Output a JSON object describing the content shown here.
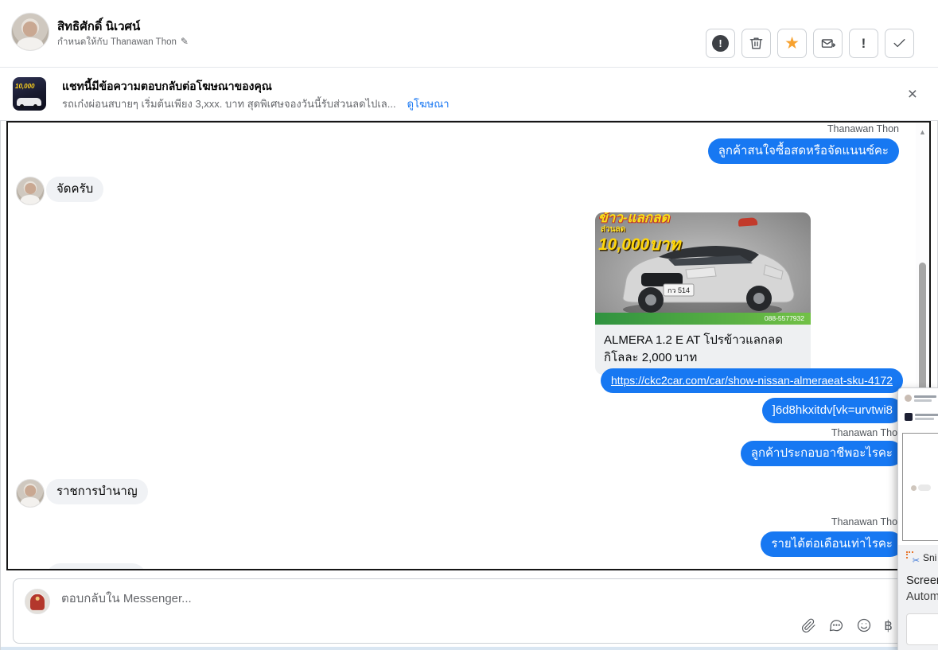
{
  "header": {
    "contact_name": "สิทธิศักดิ์ นิเวศน์",
    "assignment": "กำหนดให้กับ Thanawan Thon",
    "edit_glyph": "✎",
    "toolbar": {
      "report_glyph": "!",
      "star_glyph": "★",
      "important_glyph": "!"
    }
  },
  "ad_banner": {
    "title": "แชทนี้มีข้อความตอบกลับต่อโฆษณาของคุณ",
    "description": "รถเก๋งผ่อนสบายๆ เริ่มต้นเพียง 3,xxx. บาท สุดพิเศษจองวันนี้รับส่วนลดไปเล...",
    "view_ad": "ดูโฆษณา",
    "close_glyph": "×",
    "thumb_discount": "10,000"
  },
  "chat": {
    "agent_name": "Thanawan Thon",
    "msg_interest": "ลูกค้าสนใจซื้อสดหรือจัดแนนซ์คะ",
    "msg_finance": "จัดครับ",
    "car_url": "https://ckc2car.com/car/show-nissan-almeraeat-sku-4172",
    "msg_code": "]6d8hkxitdv[vk=urvtwi8",
    "msg_occupation": "ลูกค้าประกอบอาชีพอะไรคะ",
    "msg_pension": "ราชการบำนาญ",
    "msg_income": "รายได้ต่อเดือนเท่าไรคะ",
    "scroll_up_glyph": "▲",
    "car_card": {
      "promo_top": "ข้าว-แลกลด",
      "promo_discount_label": "ส่วนลด",
      "promo_amount": "10,000บาท",
      "license_plate": "กว 514",
      "strip_phone": "088-5577932",
      "caption": "ALMERA 1.2 E AT โปรข้าวแลกลด กิโลละ 2,000 บาท"
    }
  },
  "composer": {
    "placeholder": "ตอบกลับใน Messenger...",
    "baht_glyph": "฿"
  },
  "snip_popup": {
    "app_name": "Sni",
    "line1": "Screen",
    "line2": "Autom",
    "scissors_glyph": "✂"
  },
  "colors": {
    "bubble_blue": "#1778f2",
    "link_blue": "#1877f2",
    "star_orange": "#f7a230"
  }
}
